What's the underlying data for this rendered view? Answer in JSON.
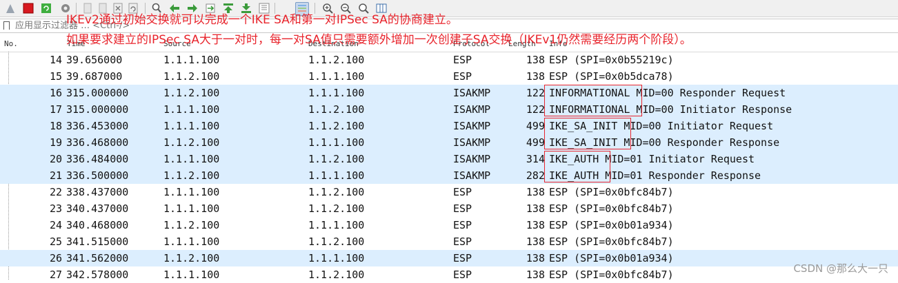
{
  "toolbar": {
    "icons": [
      "shark-fin-start-icon",
      "stop-icon",
      "restart-icon",
      "options-icon",
      "open-file-icon",
      "save-file-icon",
      "close-file-icon",
      "reload-icon",
      "find-icon",
      "go-back-icon",
      "go-forward-icon",
      "go-to-packet-icon",
      "first-packet-icon",
      "last-packet-icon",
      "auto-scroll-icon",
      "colorize-icon",
      "zoom-in-icon",
      "zoom-out-icon",
      "normal-size-icon",
      "resize-columns-icon"
    ]
  },
  "filter": {
    "placeholder": "应用显示过滤器 … <Ctrl-/>"
  },
  "columns": {
    "no": "No.",
    "time": "Time",
    "source": "Source",
    "destination": "Destination",
    "protocol": "Protocol",
    "length": "Length",
    "info": "Info"
  },
  "packets": [
    {
      "no": "14",
      "time": "39.656000",
      "src": "1.1.1.100",
      "dst": "1.1.2.100",
      "proto": "ESP",
      "len": "138",
      "info": "ESP (SPI=0x0b55219c)",
      "highlighted": false
    },
    {
      "no": "15",
      "time": "39.687000",
      "src": "1.1.2.100",
      "dst": "1.1.1.100",
      "proto": "ESP",
      "len": "138",
      "info": "ESP (SPI=0x0b5dca78)",
      "highlighted": false
    },
    {
      "no": "16",
      "time": "315.000000",
      "src": "1.1.2.100",
      "dst": "1.1.1.100",
      "proto": "ISAKMP",
      "len": "122",
      "info": "INFORMATIONAL MID=00 Responder Request",
      "highlighted": true
    },
    {
      "no": "17",
      "time": "315.000000",
      "src": "1.1.1.100",
      "dst": "1.1.2.100",
      "proto": "ISAKMP",
      "len": "122",
      "info": "INFORMATIONAL MID=00 Initiator Response",
      "highlighted": true
    },
    {
      "no": "18",
      "time": "336.453000",
      "src": "1.1.1.100",
      "dst": "1.1.2.100",
      "proto": "ISAKMP",
      "len": "499",
      "info": "IKE_SA_INIT MID=00 Initiator Request",
      "highlighted": true
    },
    {
      "no": "19",
      "time": "336.468000",
      "src": "1.1.2.100",
      "dst": "1.1.1.100",
      "proto": "ISAKMP",
      "len": "499",
      "info": "IKE_SA_INIT MID=00 Responder Response",
      "highlighted": true
    },
    {
      "no": "20",
      "time": "336.484000",
      "src": "1.1.1.100",
      "dst": "1.1.2.100",
      "proto": "ISAKMP",
      "len": "314",
      "info": "IKE_AUTH MID=01 Initiator Request",
      "highlighted": true
    },
    {
      "no": "21",
      "time": "336.500000",
      "src": "1.1.2.100",
      "dst": "1.1.1.100",
      "proto": "ISAKMP",
      "len": "282",
      "info": "IKE_AUTH MID=01 Responder Response",
      "highlighted": true
    },
    {
      "no": "22",
      "time": "338.437000",
      "src": "1.1.1.100",
      "dst": "1.1.2.100",
      "proto": "ESP",
      "len": "138",
      "info": "ESP (SPI=0x0bfc84b7)",
      "highlighted": false
    },
    {
      "no": "23",
      "time": "340.437000",
      "src": "1.1.1.100",
      "dst": "1.1.2.100",
      "proto": "ESP",
      "len": "138",
      "info": "ESP (SPI=0x0bfc84b7)",
      "highlighted": false
    },
    {
      "no": "24",
      "time": "340.468000",
      "src": "1.1.2.100",
      "dst": "1.1.1.100",
      "proto": "ESP",
      "len": "138",
      "info": "ESP (SPI=0x0b01a934)",
      "highlighted": false
    },
    {
      "no": "25",
      "time": "341.515000",
      "src": "1.1.1.100",
      "dst": "1.1.2.100",
      "proto": "ESP",
      "len": "138",
      "info": "ESP (SPI=0x0bfc84b7)",
      "highlighted": false
    },
    {
      "no": "26",
      "time": "341.562000",
      "src": "1.1.2.100",
      "dst": "1.1.1.100",
      "proto": "ESP",
      "len": "138",
      "info": "ESP (SPI=0x0b01a934)",
      "highlighted": true
    },
    {
      "no": "27",
      "time": "342.578000",
      "src": "1.1.1.100",
      "dst": "1.1.2.100",
      "proto": "ESP",
      "len": "138",
      "info": "ESP (SPI=0x0bfc84b7)",
      "highlighted": false
    }
  ],
  "annotations": {
    "line1": "IKEv2通过初始交换就可以完成一个IKE SA和第一对IPSec SA的协商建立。",
    "line2": "如果要求建立的IPSec SA大于一对时，每一对SA值只需要额外增加一次创建子SA交换（IKEv1仍然需要经历两个阶段）。"
  },
  "watermark": "CSDN @那么大一只",
  "colors": {
    "annotation_red": "#e8242c",
    "highlight_row_blue": "#dceefe"
  }
}
